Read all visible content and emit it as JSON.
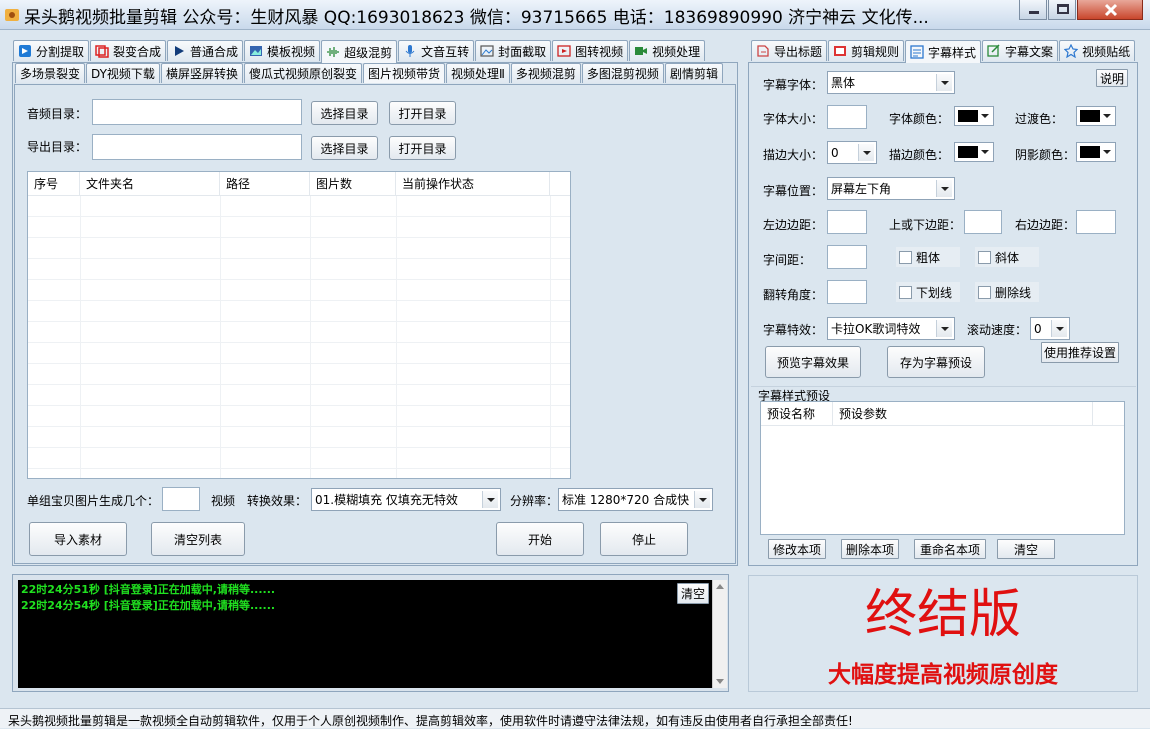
{
  "window": {
    "title": "呆头鹅视频批量剪辑 公众号：生财风暴 QQ:1693018623 微信：93715665 电话：18369890990 济宁神云 文化传..."
  },
  "main_tabs": [
    {
      "label": "分割提取",
      "icon": "split-icon"
    },
    {
      "label": "裂变合成",
      "icon": "fission-icon"
    },
    {
      "label": "普通合成",
      "icon": "play-icon"
    },
    {
      "label": "模板视频",
      "icon": "template-icon"
    },
    {
      "label": "超级混剪",
      "icon": "audio-wave-icon"
    },
    {
      "label": "文音互转",
      "icon": "microphone-icon"
    },
    {
      "label": "封面截取",
      "icon": "image-icon"
    },
    {
      "label": "图转视频",
      "icon": "video-icon"
    },
    {
      "label": "视频处理",
      "icon": "video-process-icon"
    }
  ],
  "sub_tabs": [
    "多场景裂变",
    "DY视频下载",
    "横屏竖屏转换",
    "傻瓜式视频原创裂变",
    "图片视频带货",
    "视频处理Ⅱ",
    "多视频混剪",
    "多图混剪视频",
    "剧情剪辑"
  ],
  "form": {
    "audio_dir_label": "音频目录：",
    "audio_dir_value": "",
    "export_dir_label": "导出目录：",
    "export_dir_value": "",
    "select_dir": "选择目录",
    "open_dir": "打开目录"
  },
  "table": {
    "columns": [
      "序号",
      "文件夹名",
      "路径",
      "图片数",
      "当前操作状态"
    ],
    "rows": []
  },
  "options": {
    "per_group_label": "单组宝贝图片生成几个：",
    "per_group_value": "",
    "video_label": "视频",
    "effect_label": "转换效果：",
    "effect_value": "01.模糊填充 仅填充无特效",
    "resolution_label": "分辨率：",
    "resolution_value": "标准 1280*720 合成快"
  },
  "actions": {
    "import": "导入素材",
    "clear": "清空列表",
    "start": "开始",
    "stop": "停止"
  },
  "log": {
    "clear": "清空",
    "lines": [
      "22时24分51秒 [抖音登录]正在加载中,请稍等......",
      "22时24分54秒 [抖音登录]正在加载中,请稍等......"
    ]
  },
  "right_tabs": [
    {
      "label": "导出标题",
      "icon": "export-title-icon"
    },
    {
      "label": "剪辑规则",
      "icon": "rules-icon"
    },
    {
      "label": "字幕样式",
      "icon": "subtitle-style-icon"
    },
    {
      "label": "字幕文案",
      "icon": "subtitle-text-icon"
    },
    {
      "label": "视频贴纸",
      "icon": "sticker-icon"
    }
  ],
  "subtitle": {
    "help": "说明",
    "font_label": "字幕字体：",
    "font_value": "黑体",
    "size_label": "字体大小：",
    "size_value": "",
    "font_color_label": "字体颜色：",
    "transition_color_label": "过渡色：",
    "stroke_size_label": "描边大小：",
    "stroke_size_value": "0",
    "stroke_color_label": "描边颜色：",
    "shadow_color_label": "阴影颜色：",
    "position_label": "字幕位置：",
    "position_value": "屏幕左下角",
    "left_margin_label": "左边边距：",
    "updown_margin_label": "上或下边距：",
    "right_margin_label": "右边边距：",
    "spacing_label": "字间距：",
    "bold": "粗体",
    "italic": "斜体",
    "rotate_label": "翻转角度：",
    "underline": "下划线",
    "strikethrough": "删除线",
    "effect_label": "字幕特效：",
    "effect_value": "卡拉OK歌词特效",
    "scroll_label": "滚动速度：",
    "scroll_value": "0",
    "preview": "预览字幕效果",
    "save_preset": "存为字幕预设",
    "use_recommended": "使用推荐设置",
    "preset_title": "字幕样式预设",
    "preset_columns": [
      "预设名称",
      "预设参数"
    ],
    "modify": "修改本项",
    "delete": "删除本项",
    "rename": "重命名本项",
    "clear": "清空"
  },
  "banner": {
    "title": "终结版",
    "subtitle": "大幅度提高视频原创度"
  },
  "status_bar": "呆头鹅视频批量剪辑是一款视频全自动剪辑软件，仅用于个人原创视频制作、提高剪辑效率，使用软件时请遵守法律法规，如有违反由使用者自行承担全部责任!",
  "colors": {
    "panel_bg": "#dbe6ef",
    "log_text": "#20e020",
    "banner_red": "#e01010",
    "swatch": "#000000"
  }
}
